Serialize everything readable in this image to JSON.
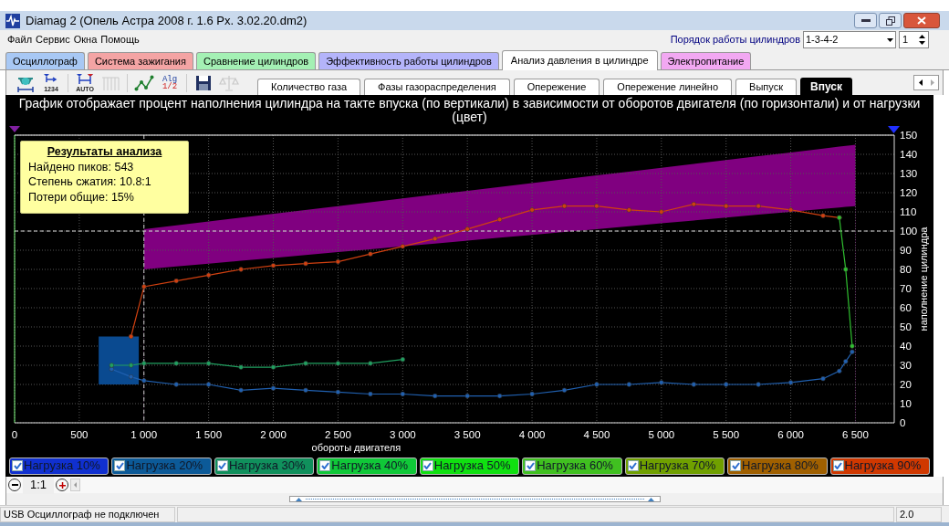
{
  "window": {
    "title": "Diamag 2 (Опель Астра 2008 г. 1.6 Px. 3.02.20.dm2)"
  },
  "menu": [
    "Файл",
    "Сервис",
    "Окна",
    "Помощь"
  ],
  "cylinder_order": {
    "label": "Порядок работы цилиндров",
    "value": "1-3-4-2",
    "spinner": "1"
  },
  "tabs": [
    {
      "label": "Осциллограф",
      "selected": false,
      "color": "#a8c8f4"
    },
    {
      "label": "Система зажигания",
      "selected": false,
      "color": "#f4a4a4"
    },
    {
      "label": "Сравнение цилиндров",
      "selected": false,
      "color": "#a4f0b4"
    },
    {
      "label": "Эффективность работы цилиндров",
      "selected": false,
      "color": "#b4b4fa"
    },
    {
      "label": "Анализ давления в цилиндре",
      "selected": true,
      "color": "#ffffff"
    },
    {
      "label": "Электропитание",
      "selected": false,
      "color": "#f2a8f2"
    }
  ],
  "toolbar": [
    {
      "kind": "sensor",
      "disabled": false
    },
    {
      "kind": "measure",
      "caption": "1234",
      "disabled": false
    },
    {
      "kind": "auto",
      "caption": "AUTO",
      "disabled": false
    },
    {
      "kind": "comb",
      "disabled": true
    },
    {
      "kind": "points",
      "disabled": false
    },
    {
      "kind": "alg",
      "caption": "Alg",
      "sub": "1/2",
      "disabled": false
    },
    {
      "kind": "save",
      "disabled": false
    },
    {
      "kind": "scales",
      "disabled": true
    }
  ],
  "subtabs": [
    {
      "label": "Количество газа",
      "selected": false
    },
    {
      "label": "Фазы газораспределения",
      "selected": false
    },
    {
      "label": "Опережение",
      "selected": false
    },
    {
      "label": "Опережение линейно",
      "selected": false
    },
    {
      "label": "Выпуск",
      "selected": false
    },
    {
      "label": "Впуск",
      "selected": true
    }
  ],
  "chart_title": "График отображает процент наполнения цилиндра на такте впуска (по вертикали) в зависимости от оборотов двигателя (по горизонтали) и от нагрузки (цвет)",
  "results": {
    "title": "Результаты анализа",
    "lines": [
      "Найдено пиков: 543",
      "Степень сжатия: 10.8:1",
      "Потери общие: 15%"
    ]
  },
  "chart_data": {
    "type": "line",
    "xlabel": "обороты двигателя",
    "ylabel": "наполнение цилиндра",
    "xlim": [
      0,
      6800
    ],
    "ylim": [
      0,
      150
    ],
    "x": [
      750,
      900,
      1000,
      1250,
      1500,
      1750,
      2000,
      2250,
      2500,
      2750,
      3000,
      3250,
      3500,
      3750,
      4000,
      4250,
      4500,
      4750,
      5000,
      5250,
      5500,
      5750,
      6000,
      6250,
      6375,
      6425,
      6475,
      6500
    ],
    "series": [
      {
        "type": "area",
        "color": "#000000",
        "values": [
          null,
          null,
          80,
          81.5,
          83,
          84.5,
          86,
          87.5,
          89,
          90.5,
          92,
          93.5,
          95,
          96.5,
          98,
          99.5,
          101,
          102.5,
          104,
          105.5,
          107,
          108.5,
          110,
          111.5,
          112.3,
          112.6,
          112.9,
          113
        ]
      },
      {
        "type": "area",
        "color": "#800080",
        "values": [
          null,
          null,
          101,
          null,
          null,
          null,
          null,
          null,
          113,
          115,
          117,
          119,
          121,
          123,
          125,
          127,
          129,
          131,
          133,
          135,
          137,
          139,
          141,
          143,
          144,
          144.4,
          144.8,
          145
        ]
      },
      {
        "type": "line",
        "color": "#2060b0",
        "values": [
          28,
          24,
          22,
          20,
          20,
          17,
          18,
          17,
          16,
          15,
          15,
          14,
          14,
          14,
          15,
          17,
          20,
          20,
          21,
          20,
          20,
          20,
          21,
          23,
          27,
          32,
          37,
          null
        ]
      },
      {
        "type": "line",
        "color": "#20a060",
        "values": [
          30,
          30,
          31,
          31,
          31,
          29,
          29,
          31,
          31,
          31,
          33,
          null,
          null,
          null,
          null,
          null,
          null,
          null,
          null,
          null,
          null,
          null,
          null,
          null,
          null,
          null,
          null,
          null
        ]
      },
      {
        "type": "line",
        "color": "#d04010",
        "values": [
          null,
          45,
          71,
          74,
          77,
          80,
          82,
          83,
          84,
          88,
          92,
          96,
          101,
          106,
          111,
          113,
          113,
          111,
          110,
          114,
          113,
          113,
          111,
          108,
          107,
          null,
          null,
          null
        ]
      },
      {
        "type": "line",
        "color": "#30c030",
        "values": [
          null,
          null,
          null,
          null,
          null,
          null,
          null,
          null,
          null,
          null,
          null,
          null,
          null,
          null,
          null,
          null,
          null,
          null,
          null,
          null,
          null,
          null,
          null,
          null,
          107,
          80,
          40,
          null
        ]
      }
    ],
    "xticks": [
      0,
      500,
      {
        "value": 1000,
        "label": "1 000"
      },
      {
        "value": 1500,
        "label": "1 500"
      },
      {
        "value": 2000,
        "label": "2 000"
      },
      {
        "value": 2500,
        "label": "2 500"
      },
      {
        "value": 3000,
        "label": "3 000"
      },
      {
        "value": 3500,
        "label": "3 500"
      },
      {
        "value": 4000,
        "label": "4 000"
      },
      {
        "value": 4500,
        "label": "4 500"
      },
      {
        "value": 5000,
        "label": "5 000"
      },
      {
        "value": 5500,
        "label": "5 500"
      },
      {
        "value": 6000,
        "label": "6 000"
      },
      {
        "value": 6500,
        "label": "6 500"
      }
    ],
    "yticks": [
      0,
      10,
      20,
      30,
      40,
      50,
      60,
      70,
      80,
      90,
      100,
      110,
      120,
      130,
      140,
      150
    ],
    "grid": true,
    "ref_lines": [
      {
        "axis": "y",
        "value": 100
      },
      {
        "axis": "x",
        "value": 1000
      }
    ]
  },
  "legend": [
    {
      "label": "Нагрузка 10%",
      "checked": true,
      "color": "#1030d0"
    },
    {
      "label": "Нагрузка 20%",
      "checked": true,
      "color": "#0c5a98"
    },
    {
      "label": "Нагрузка 30%",
      "checked": true,
      "color": "#10905c"
    },
    {
      "label": "Нагрузка 40%",
      "checked": true,
      "color": "#10c838"
    },
    {
      "label": "Нагрузка 50%",
      "checked": true,
      "color": "#10e010"
    },
    {
      "label": "Нагрузка 60%",
      "checked": true,
      "color": "#40c020"
    },
    {
      "label": "Нагрузка 70%",
      "checked": true,
      "color": "#70a000"
    },
    {
      "label": "Нагрузка 80%",
      "checked": true,
      "color": "#a06000"
    },
    {
      "label": "Нагрузка 90%",
      "checked": true,
      "color": "#d03800"
    }
  ],
  "zoom": {
    "scale": "1:1"
  },
  "status_bar": {
    "message": "USB Осциллограф не подключен",
    "version": "2.0"
  }
}
